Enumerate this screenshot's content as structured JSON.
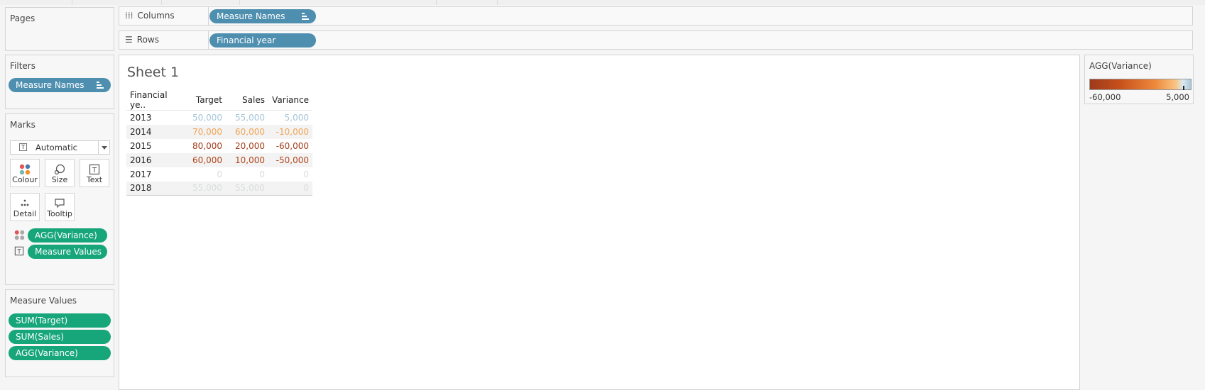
{
  "pages": {
    "title": "Pages"
  },
  "filters": {
    "title": "Filters",
    "pills": [
      {
        "label": "Measure Names"
      }
    ]
  },
  "columns": {
    "label": "Columns",
    "pill": "Measure Names"
  },
  "rows": {
    "label": "Rows",
    "pill": "Financial year"
  },
  "marks": {
    "title": "Marks",
    "type": "Automatic",
    "buttons": {
      "colour": "Colour",
      "size": "Size",
      "text": "Text",
      "detail": "Detail",
      "tooltip": "Tooltip"
    },
    "fields": [
      {
        "label": "AGG(Variance)",
        "icon": "colour-icon"
      },
      {
        "label": "Measure Values",
        "icon": "text-icon"
      }
    ]
  },
  "measure_values": {
    "title": "Measure Values",
    "pills": [
      {
        "label": "SUM(Target)"
      },
      {
        "label": "SUM(Sales)"
      },
      {
        "label": "AGG(Variance)"
      }
    ]
  },
  "sheet": {
    "title": "Sheet 1",
    "headers": [
      "Financial ye..",
      "Target",
      "Sales",
      "Variance"
    ],
    "rows": [
      {
        "year": "2013",
        "target": "50,000",
        "sales": "55,000",
        "variance": "5,000",
        "color": "#a6c6da"
      },
      {
        "year": "2014",
        "target": "70,000",
        "sales": "60,000",
        "variance": "-10,000",
        "color": "#f2a455"
      },
      {
        "year": "2015",
        "target": "80,000",
        "sales": "20,000",
        "variance": "-60,000",
        "color": "#a23c1a"
      },
      {
        "year": "2016",
        "target": "60,000",
        "sales": "10,000",
        "variance": "-50,000",
        "color": "#b0461b"
      },
      {
        "year": "2017",
        "target": "0",
        "sales": "0",
        "variance": "0",
        "color": "#d9dcdd"
      },
      {
        "year": "2018",
        "target": "55,000",
        "sales": "55,000",
        "variance": "0",
        "color": "#d9dcdd"
      }
    ]
  },
  "legend": {
    "title": "AGG(Variance)",
    "min": "-60,000",
    "max": "5,000"
  }
}
